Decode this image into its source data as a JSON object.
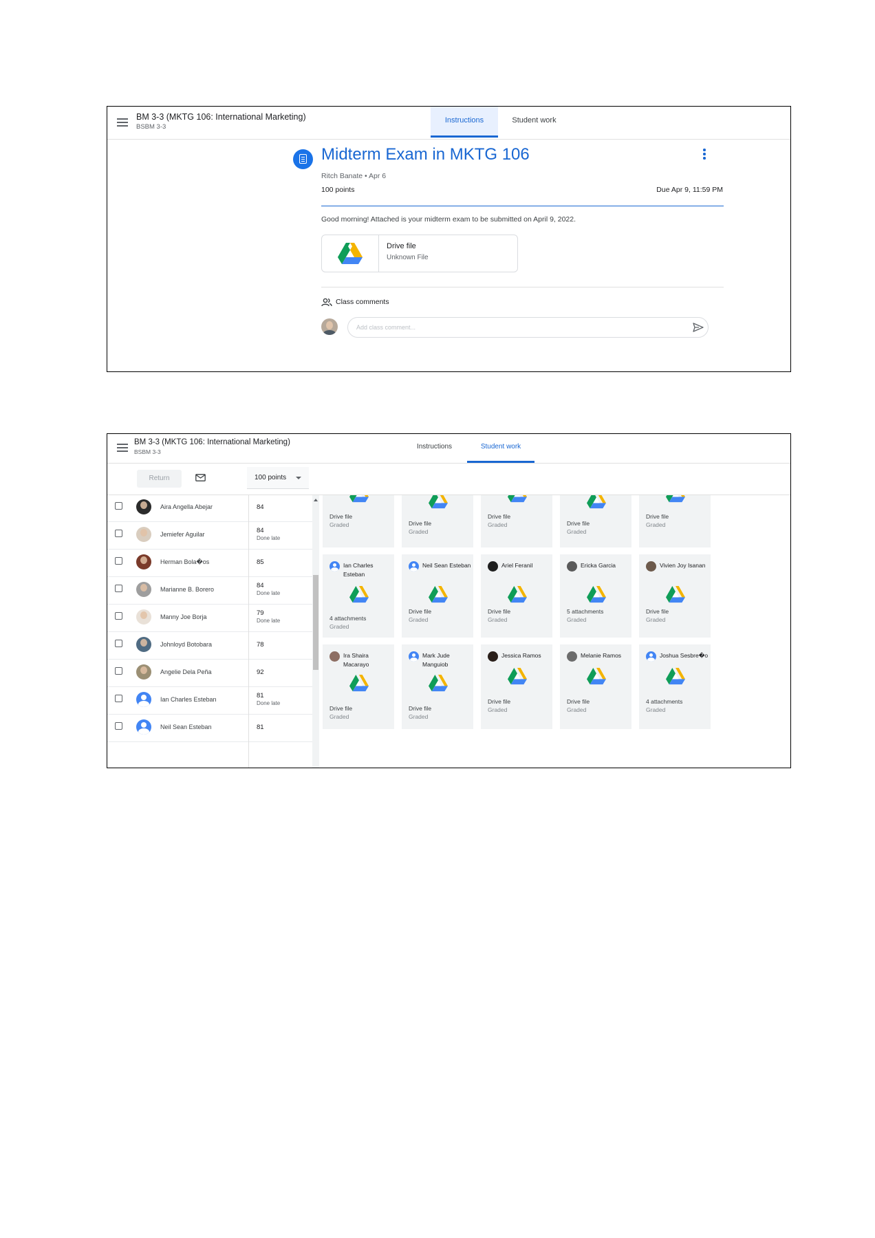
{
  "class": {
    "title": "BM 3-3 (MKTG 106: International Marketing)",
    "section": "BSBM 3-3"
  },
  "tabs": [
    {
      "label": "Instructions"
    },
    {
      "label": "Student work"
    }
  ],
  "assignment": {
    "title": "Midterm Exam in MKTG 106",
    "meta": "Ritch Banate • Apr 6",
    "points": "100 points",
    "due": "Due Apr 9, 11:59 PM",
    "description": "Good morning! Attached is your midterm exam to be submitted on April 9, 2022.",
    "attachment": {
      "title": "Drive file",
      "subtitle": "Unknown File"
    },
    "comments_label": "Class comments",
    "comment_placeholder": "Add class comment..."
  },
  "toolbar": {
    "return_label": "Return",
    "points_value": "100 points"
  },
  "students": [
    {
      "name": "Aira Angella Abejar",
      "grade": "84",
      "status": ""
    },
    {
      "name": "Jemiefer Aguilar",
      "grade": "84",
      "status": "Done late"
    },
    {
      "name": "Herman Bola�os",
      "grade": "85",
      "status": ""
    },
    {
      "name": "Marianne B. Borero",
      "grade": "84",
      "status": "Done late"
    },
    {
      "name": "Manny Joe Borja",
      "grade": "79",
      "status": "Done late"
    },
    {
      "name": "Johnloyd Botobara",
      "grade": "78",
      "status": ""
    },
    {
      "name": "Angelie Dela Peña",
      "grade": "92",
      "status": ""
    },
    {
      "name": "Ian Charles Esteban",
      "grade": "81",
      "status": "Done late"
    },
    {
      "name": "Neil Sean Esteban",
      "grade": "81",
      "status": ""
    }
  ],
  "cards_top": [
    {
      "file": "Drive file",
      "status": "Graded"
    },
    {
      "file": "Drive file",
      "status": "Graded"
    },
    {
      "file": "Drive file",
      "status": "Graded"
    },
    {
      "file": "Drive file",
      "status": "Graded"
    },
    {
      "file": "Drive file",
      "status": "Graded"
    }
  ],
  "cards_mid": [
    {
      "name": "Ian Charles Esteban",
      "file": "4 attachments",
      "status": "Graded"
    },
    {
      "name": "Neil Sean Esteban",
      "file": "Drive file",
      "status": "Graded"
    },
    {
      "name": "Ariel Feranil",
      "file": "Drive file",
      "status": "Graded"
    },
    {
      "name": "Ericka Garcia",
      "file": "5 attachments",
      "status": "Graded"
    },
    {
      "name": "Vivien Joy Isanan",
      "file": "Drive file",
      "status": "Graded"
    }
  ],
  "cards_bottom": [
    {
      "name": "Ira Shaira Macarayo",
      "file": "Drive file",
      "status": "Graded"
    },
    {
      "name": "Mark Jude Manguiob",
      "file": "Drive file",
      "status": "Graded"
    },
    {
      "name": "Jessica Ramos",
      "file": "Drive file",
      "status": "Graded"
    },
    {
      "name": "Melanie Ramos",
      "file": "Drive file",
      "status": "Graded"
    },
    {
      "name": "Joshua Sesbre�o",
      "file": "4 attachments",
      "status": "Graded"
    }
  ],
  "colors": {
    "accent": "#1967d2",
    "card_bg": "#f1f3f4",
    "drive_green": "#0f9d58",
    "drive_yellow": "#f4b400",
    "drive_blue": "#4285f4"
  },
  "icons": [
    "menu-icon",
    "assignment-icon",
    "more-vert-icon",
    "drive-icon",
    "people-icon",
    "send-icon",
    "mail-icon",
    "dropdown-caret-icon",
    "checkbox-icon",
    "avatar"
  ]
}
